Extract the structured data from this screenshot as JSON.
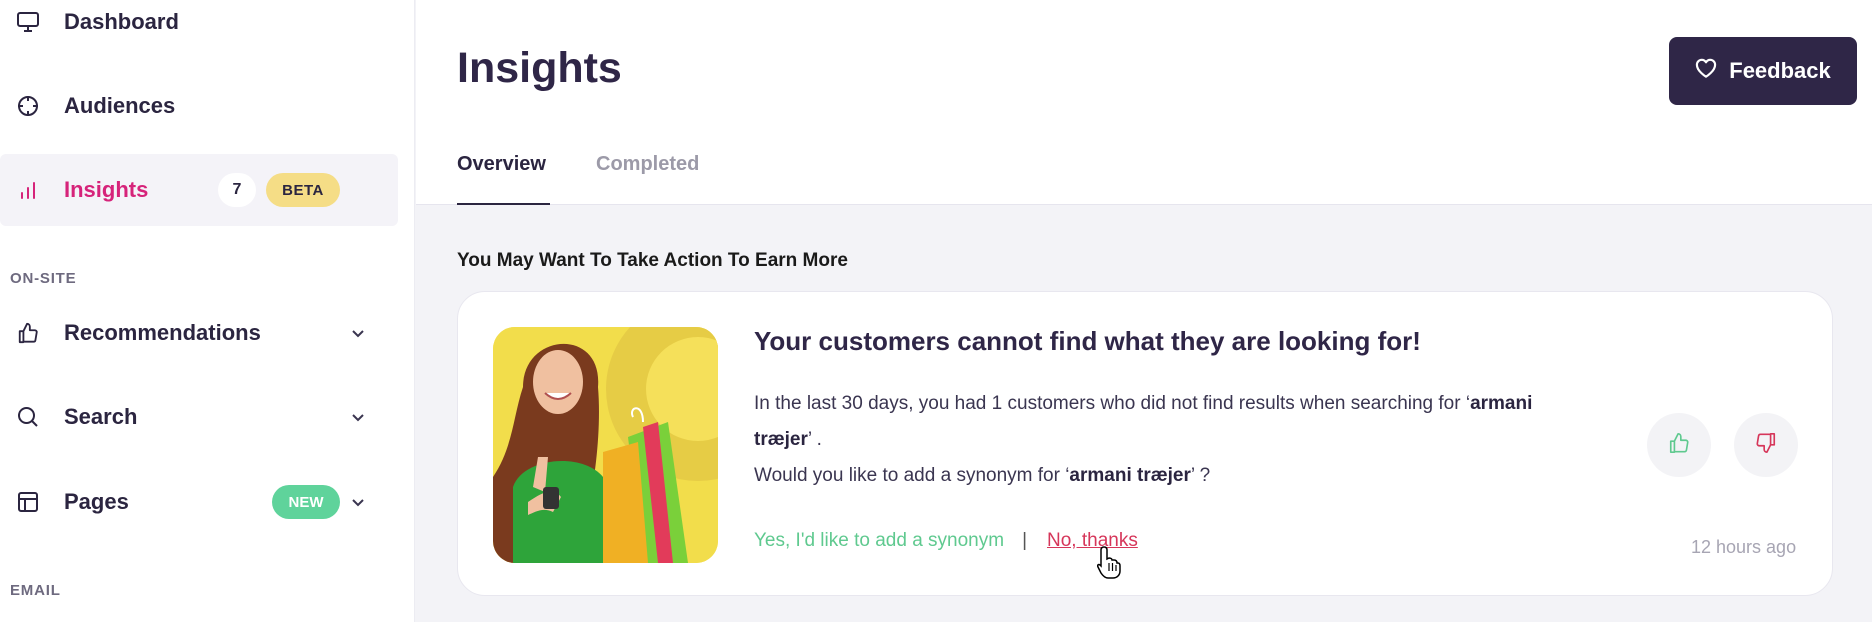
{
  "sidebar": {
    "items": [
      {
        "label": "Dashboard",
        "icon": "monitor-icon"
      },
      {
        "label": "Audiences",
        "icon": "crosshair-icon"
      },
      {
        "label": "Insights",
        "icon": "bar-chart-icon",
        "count": "7",
        "badge": "BETA",
        "active": true
      },
      {
        "label": "Recommendations",
        "icon": "thumbs-up-icon"
      },
      {
        "label": "Search",
        "icon": "search-icon"
      },
      {
        "label": "Pages",
        "icon": "layout-icon",
        "badge": "NEW"
      }
    ],
    "sections": {
      "onsite": "ON-SITE",
      "email": "EMAIL"
    }
  },
  "header": {
    "title": "Insights",
    "feedback_label": "Feedback"
  },
  "tabs": [
    {
      "label": "Overview",
      "active": true
    },
    {
      "label": "Completed",
      "active": false
    }
  ],
  "section_heading": "You May Want To Take Action To Earn More",
  "card": {
    "title": "Your customers cannot find what they are looking for!",
    "body_pre": "In the last 30 days, you had 1 customers who did not find results when searching for ‘",
    "search_term": "armani træjer",
    "body_post": "’ .",
    "question_pre": "Would you like to add a synonym for ‘",
    "question_post": "’ ?",
    "yes_label": "Yes, I'd like to add a synonym",
    "separator": "|",
    "no_label": "No, thanks",
    "timestamp": "12 hours ago"
  },
  "colors": {
    "accent": "#d6237a",
    "brand_dark": "#2f2647",
    "success": "#5fc98f",
    "danger": "#d6365a",
    "beta": "#f5dd86",
    "new": "#5fd39b"
  }
}
